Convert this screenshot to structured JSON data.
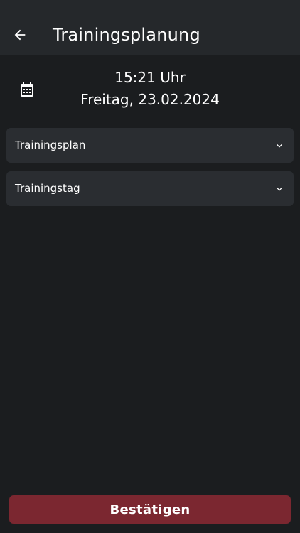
{
  "header": {
    "title": "Trainingsplanung",
    "back_icon": "arrow-left-icon"
  },
  "datetime": {
    "time": "15:21 Uhr",
    "date": "Freitag, 23.02.2024",
    "icon": "calendar-icon"
  },
  "dropdowns": [
    {
      "label": "Trainingsplan",
      "icon": "chevron-down-icon"
    },
    {
      "label": "Trainingstag",
      "icon": "chevron-down-icon"
    }
  ],
  "footer": {
    "confirm_label": "Bestätigen"
  },
  "colors": {
    "background": "#1b1d1f",
    "app_bar": "#25282b",
    "dropdown_bg": "#2a2d31",
    "accent": "#7b2730",
    "text": "#ffffff"
  }
}
